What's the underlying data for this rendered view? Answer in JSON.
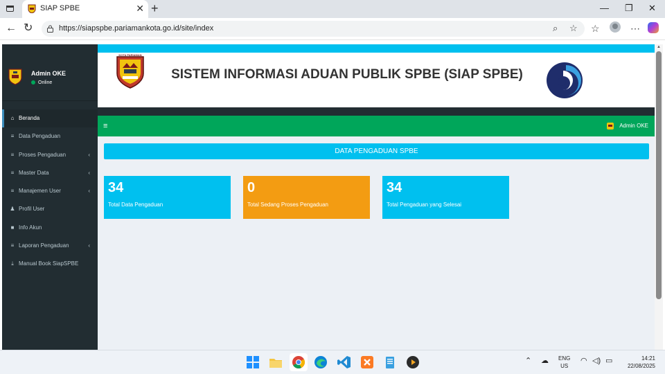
{
  "browser": {
    "tab_title": "SIAP SPBE",
    "url": "https://siapspbe.pariamankota.go.id/site/index"
  },
  "sidebar": {
    "user_name": "Admin OKE",
    "user_status": "Online",
    "items": [
      {
        "label": "Beranda",
        "icon": "home-icon",
        "active": true,
        "has_submenu": false
      },
      {
        "label": "Data Pengaduan",
        "icon": "list-icon",
        "active": false,
        "has_submenu": false
      },
      {
        "label": "Proses Pengaduan",
        "icon": "list-icon",
        "active": false,
        "has_submenu": true
      },
      {
        "label": "Master Data",
        "icon": "list-icon",
        "active": false,
        "has_submenu": true
      },
      {
        "label": "Manajemen User",
        "icon": "list-icon",
        "active": false,
        "has_submenu": true
      },
      {
        "label": "Profil User",
        "icon": "user-icon",
        "active": false,
        "has_submenu": false
      },
      {
        "label": "Info Akun",
        "icon": "lock-icon",
        "active": false,
        "has_submenu": false
      },
      {
        "label": "Laporan Pengaduan",
        "icon": "list-icon",
        "active": false,
        "has_submenu": true
      },
      {
        "label": "Manual Book SiapSPBE",
        "icon": "download-icon",
        "active": false,
        "has_submenu": false
      }
    ]
  },
  "banner": {
    "crest_label": "KOTA PARIAMAN",
    "title": "SISTEM INFORMASI ADUAN PUBLIK SPBE (SIAP SPBE)"
  },
  "header": {
    "user_name": "Admin OKE"
  },
  "main": {
    "section_title": "DATA PENGADUAN SPBE",
    "stats": [
      {
        "value": "34",
        "label": "Total Data Pengaduan",
        "color": "#00c0ef"
      },
      {
        "value": "0",
        "label": "Total Sedang Proses Pengaduan",
        "color": "#f39c12"
      },
      {
        "value": "34",
        "label": "Total Pengaduan yang Selesai",
        "color": "#00c0ef"
      }
    ]
  },
  "taskbar": {
    "lang_1": "ENG",
    "lang_2": "US",
    "time": "14:21",
    "date": "22/08/2025"
  },
  "colors": {
    "sidebar_bg": "#222d32",
    "header_green": "#00a65a",
    "aqua": "#00c0ef",
    "orange": "#f39c12",
    "content_bg": "#ecf0f5"
  }
}
